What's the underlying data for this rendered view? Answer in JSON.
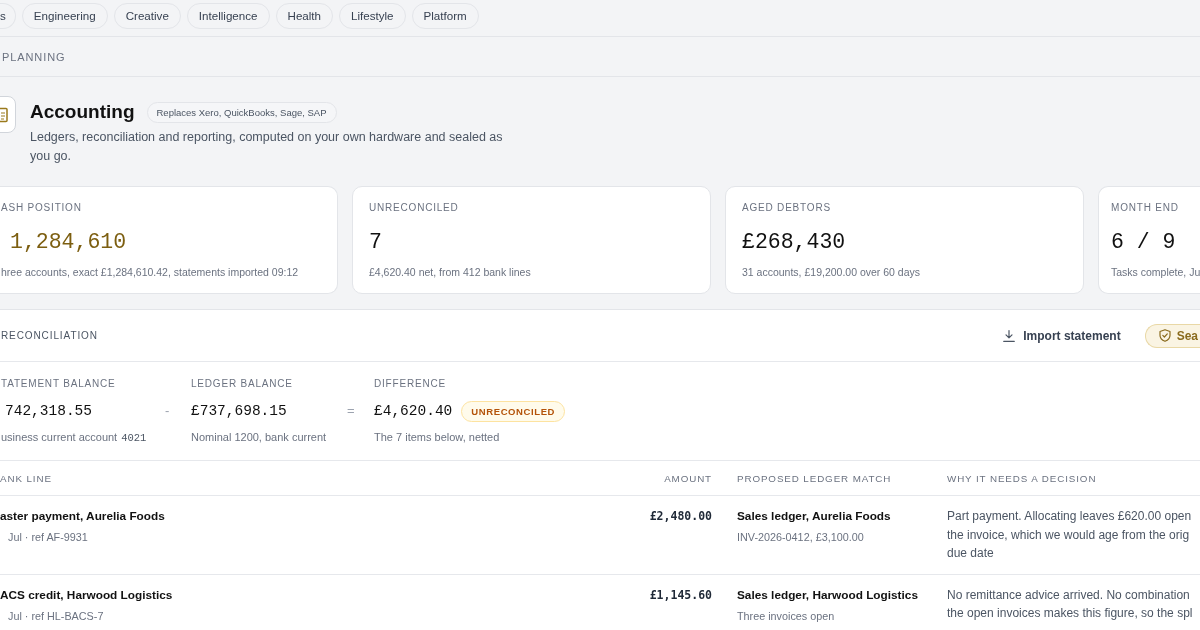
{
  "categories": [
    {
      "label": "s",
      "selected": false
    },
    {
      "label": "Engineering",
      "selected": false
    },
    {
      "label": "Creative",
      "selected": false
    },
    {
      "label": "Intelligence",
      "selected": false
    },
    {
      "label": "Health",
      "selected": false
    },
    {
      "label": "Lifestyle",
      "selected": false
    },
    {
      "label": "Platform",
      "selected": false
    }
  ],
  "section_label": "PLANNING",
  "app": {
    "title": "Accounting",
    "tag": "Replaces Xero, QuickBooks, Sage, SAP",
    "description": "Ledgers, reconciliation and reporting, computed on your own hardware and sealed as you go."
  },
  "stats": [
    {
      "label": "ASH POSITION",
      "value": "1,284,610",
      "note": "hree accounts, exact £1,284,610.42, statements imported 09:12",
      "accent": true
    },
    {
      "label": "UNRECONCILED",
      "value": "7",
      "note": "£4,620.40 net, from 412 bank lines",
      "accent": false
    },
    {
      "label": "AGED DEBTORS",
      "value": "£268,430",
      "note": "31 accounts, £19,200.00 over 60 days",
      "accent": false
    },
    {
      "label": "MONTH END",
      "value": "6 / 9",
      "note": "Tasks complete, Ju",
      "accent": false
    }
  ],
  "reconciliation": {
    "title": "RECONCILIATION",
    "actions": [
      {
        "kind": "import",
        "label": "Import statement"
      },
      {
        "kind": "seal",
        "label": "Sea"
      }
    ],
    "balances": [
      {
        "label": "TATEMENT BALANCE",
        "value": "742,318.55",
        "note": "usiness current account",
        "account": "4021",
        "operator": "-"
      },
      {
        "label": "LEDGER BALANCE",
        "value": "£737,698.15",
        "note": "Nominal 1200, bank current",
        "operator": "="
      },
      {
        "label": "DIFFERENCE",
        "value": "£4,620.40",
        "note": "The 7 items below, netted",
        "status": {
          "label": "UNRECONCILED",
          "reconciled": false
        }
      }
    ],
    "table": {
      "columns": [
        "ANK LINE",
        "AMOUNT",
        "PROPOSED LEDGER MATCH",
        "WHY IT NEEDS A DECISION"
      ],
      "rows": [
        {
          "title": "aster payment, Aurelia Foods",
          "meta": "Jul · ref AF-9931",
          "amount": "£2,480.00",
          "match": "Sales ledger, Aurelia Foods",
          "match_detail": "INV-2026-0412, £3,100.00",
          "reason": "Part payment. Allocating leaves £620.00 open\nthe invoice, which we would age from the orig\ndue date"
        },
        {
          "title": "ACS credit, Harwood Logistics",
          "meta": "Jul · ref HL-BACS-7",
          "amount": "£1,145.60",
          "match": "Sales ledger, Harwood Logistics",
          "match_detail": "Three invoices open",
          "reason": "No remittance advice arrived. No combination\nthe open invoices makes this figure, so the spl"
        }
      ]
    }
  }
}
